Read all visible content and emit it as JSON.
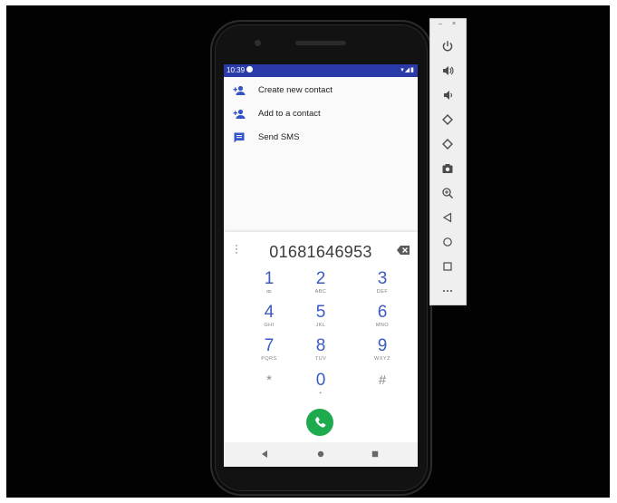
{
  "status_bar": {
    "time": "10:39",
    "icons": "▾◢▮"
  },
  "menu": [
    {
      "label": "Create new contact",
      "icon": "add-person-icon"
    },
    {
      "label": "Add to a contact",
      "icon": "add-person-icon"
    },
    {
      "label": "Send SMS",
      "icon": "message-icon"
    }
  ],
  "dialer": {
    "number": "01681646953",
    "keys": [
      {
        "digit": "1",
        "letters": "ꝏ"
      },
      {
        "digit": "2",
        "letters": "ABC"
      },
      {
        "digit": "3",
        "letters": "DEF"
      },
      {
        "digit": "4",
        "letters": "GHI"
      },
      {
        "digit": "5",
        "letters": "JKL"
      },
      {
        "digit": "6",
        "letters": "MNO"
      },
      {
        "digit": "7",
        "letters": "PQRS"
      },
      {
        "digit": "8",
        "letters": "TUV"
      },
      {
        "digit": "9",
        "letters": "WXYZ"
      },
      {
        "digit": "*",
        "letters": ""
      },
      {
        "digit": "0",
        "letters": "+"
      },
      {
        "digit": "#",
        "letters": ""
      }
    ]
  },
  "toolbar": {
    "minimize": "–",
    "close": "×"
  },
  "colors": {
    "status_bar": "#2a3aa8",
    "accent": "#3c5bbf",
    "call": "#1dab4d"
  }
}
